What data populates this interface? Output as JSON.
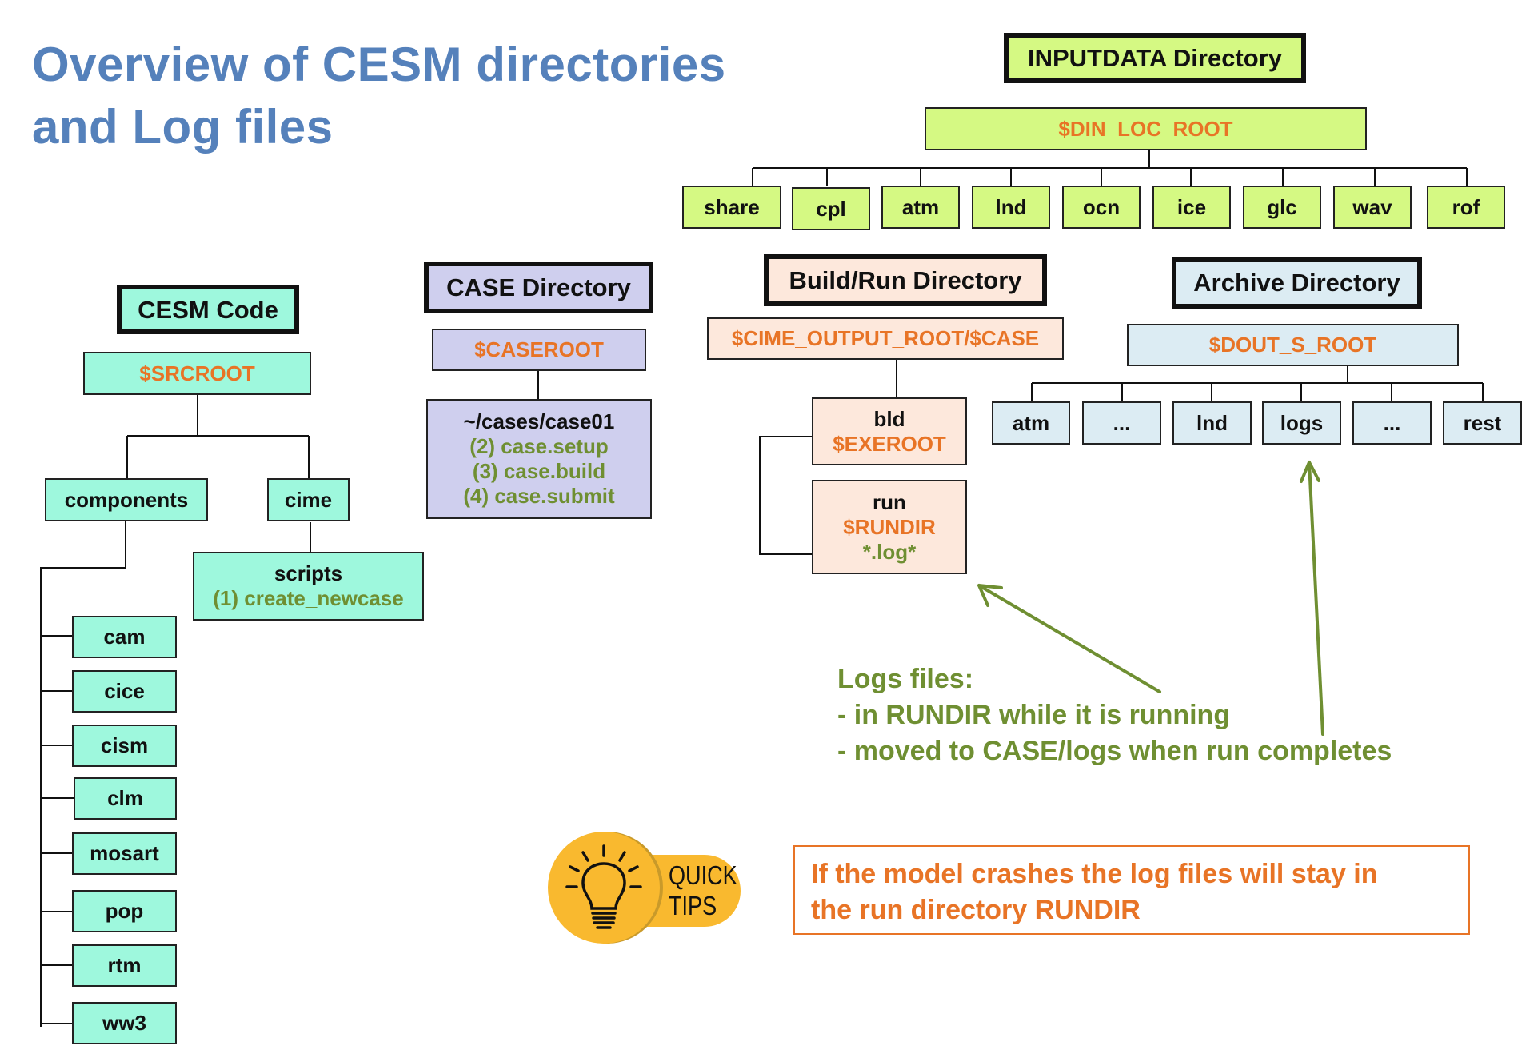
{
  "title": {
    "line1": "Overview of CESM directories",
    "line2": "and Log files"
  },
  "colors": {
    "title": "#5581bb",
    "variable": "#e87426",
    "command": "#6f8f32",
    "code_bg": "#9ef8dd",
    "case_bg": "#cfcfee",
    "build_bg": "#fde8dc",
    "archive_bg": "#dcecf3",
    "inputdata_bg": "#d5f983",
    "tips_bg": "#f9b92f"
  },
  "cesm_code": {
    "header": "CESM Code",
    "root": "$SRCROOT",
    "components": "components",
    "cime": "cime",
    "scripts": {
      "name": "scripts",
      "step": "(1) create_newcase"
    },
    "component_list": [
      "cam",
      "cice",
      "cism",
      "clm",
      "mosart",
      "pop",
      "rtm",
      "ww3"
    ]
  },
  "case_dir": {
    "header": "CASE Directory",
    "root": "$CASEROOT",
    "path": "~/cases/case01",
    "steps": [
      "(2) case.setup",
      "(3) case.build",
      "(4) case.submit"
    ]
  },
  "build_run": {
    "header": "Build/Run Directory",
    "root": "$CIME_OUTPUT_ROOT/$CASE",
    "bld": {
      "name": "bld",
      "var": "$EXEROOT"
    },
    "run": {
      "name": "run",
      "var": "$RUNDIR",
      "files": "*.log*"
    }
  },
  "archive": {
    "header": "Archive Directory",
    "root": "$DOUT_S_ROOT",
    "children": [
      "atm",
      "...",
      "lnd",
      "logs",
      "...",
      "rest"
    ]
  },
  "inputdata": {
    "header": "INPUTDATA Directory",
    "root": "$DIN_LOC_ROOT",
    "children": [
      "share",
      "cpl",
      "atm",
      "lnd",
      "ocn",
      "ice",
      "glc",
      "wav",
      "rof"
    ]
  },
  "log_note": {
    "title": "Logs files:",
    "items": [
      "- in RUNDIR while it is running",
      "- moved to CASE/logs when run completes"
    ]
  },
  "quick_tips": {
    "line1": "QUICK",
    "line2": "TIPS",
    "icon": "lightbulb-icon"
  },
  "tip_text": {
    "line1": "If the model crashes the log files will stay in",
    "line2": "the run directory RUNDIR"
  }
}
